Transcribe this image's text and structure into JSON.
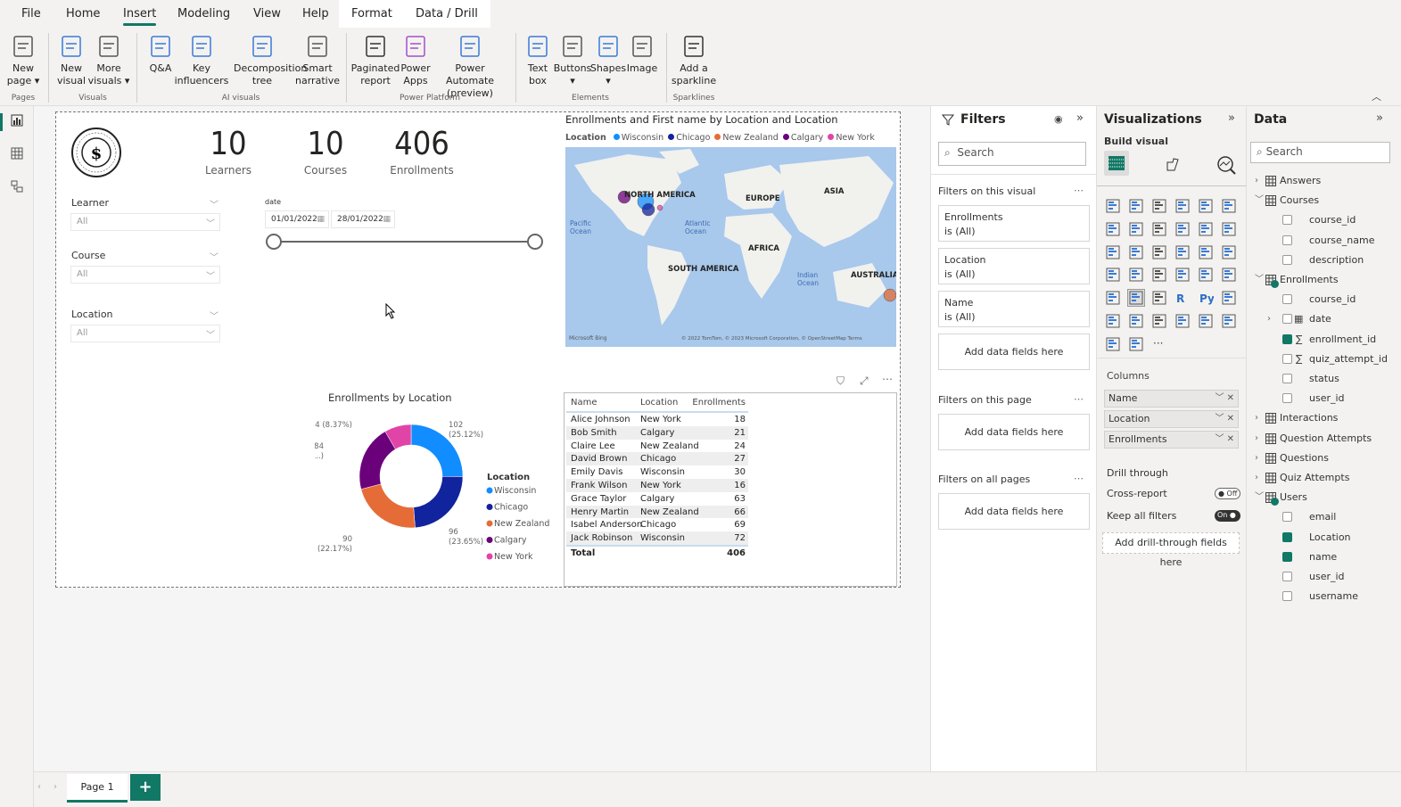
{
  "menu_tabs": [
    {
      "label": "File"
    },
    {
      "label": "Home"
    },
    {
      "label": "Insert",
      "active": true
    },
    {
      "label": "Modeling"
    },
    {
      "label": "View"
    },
    {
      "label": "Help"
    },
    {
      "label": "Format",
      "contextual": true
    },
    {
      "label": "Data / Drill",
      "contextual": true
    }
  ],
  "ribbon": {
    "buttons": [
      {
        "lines": [
          "New",
          "page ▾"
        ],
        "icon": "new-page-icon"
      },
      {
        "lines": [
          "New",
          "visual"
        ],
        "icon": "new-visual-icon"
      },
      {
        "lines": [
          "More",
          "visuals ▾"
        ],
        "icon": "more-visuals-icon"
      },
      {
        "lines": [
          "Q&A",
          ""
        ],
        "icon": "qa-icon"
      },
      {
        "lines": [
          "Key",
          "influencers"
        ],
        "icon": "key-influencers-icon"
      },
      {
        "lines": [
          "Decomposition",
          "tree"
        ],
        "icon": "decomposition-tree-icon"
      },
      {
        "lines": [
          "Smart",
          "narrative"
        ],
        "icon": "smart-narrative-icon"
      },
      {
        "lines": [
          "Paginated",
          "report"
        ],
        "icon": "paginated-report-icon"
      },
      {
        "lines": [
          "Power",
          "Apps"
        ],
        "icon": "power-apps-icon"
      },
      {
        "lines": [
          "Power Automate",
          "(preview)"
        ],
        "icon": "power-automate-icon"
      },
      {
        "lines": [
          "Text",
          "box"
        ],
        "icon": "text-box-icon"
      },
      {
        "lines": [
          "Buttons",
          "▾"
        ],
        "icon": "buttons-icon"
      },
      {
        "lines": [
          "Shapes",
          "▾"
        ],
        "icon": "shapes-icon"
      },
      {
        "lines": [
          "Image",
          ""
        ],
        "icon": "image-icon"
      },
      {
        "lines": [
          "Add a",
          "sparkline"
        ],
        "icon": "sparkline-icon"
      }
    ],
    "groups": [
      "Pages",
      "Visuals",
      "AI visuals",
      "Power Platform",
      "Elements",
      "Sparklines"
    ]
  },
  "left_rail": [
    {
      "icon": "report-view-icon"
    },
    {
      "icon": "table-view-icon"
    },
    {
      "icon": "model-view-icon"
    }
  ],
  "report": {
    "kpis": [
      {
        "value": "10",
        "label": "Learners"
      },
      {
        "value": "10",
        "label": "Courses"
      },
      {
        "value": "406",
        "label": "Enrollments"
      }
    ],
    "slicers": [
      {
        "title": "Learner",
        "value": "All"
      },
      {
        "title": "Course",
        "value": "All"
      },
      {
        "title": "Location",
        "value": "All"
      }
    ],
    "date_slicer": {
      "title": "date",
      "start": "01/01/2022",
      "end": "28/01/2022",
      "range_fraction": [
        0,
        1
      ]
    },
    "map": {
      "title": "Enrollments and First name by Location and Location",
      "legend_title": "Location",
      "labels": [
        "NORTH AMERICA",
        "EUROPE",
        "ASIA",
        "AFRICA",
        "SOUTH AMERICA",
        "AUSTRALIA",
        "Pacific Ocean",
        "Atlantic Ocean",
        "Indian Ocean"
      ],
      "attribution": "© 2022 TomTom, © 2023 Microsoft Corporation, © OpenStreetMap  Terms",
      "brand": "Microsoft Bing"
    },
    "table": {
      "headers": [
        "Name",
        "Location",
        "Enrollments"
      ],
      "rows": [
        [
          "Alice Johnson",
          "New York",
          "18"
        ],
        [
          "Bob Smith",
          "Calgary",
          "21"
        ],
        [
          "Claire Lee",
          "New Zealand",
          "24"
        ],
        [
          "David Brown",
          "Chicago",
          "27"
        ],
        [
          "Emily Davis",
          "Wisconsin",
          "30"
        ],
        [
          "Frank Wilson",
          "New York",
          "16"
        ],
        [
          "Grace Taylor",
          "Calgary",
          "63"
        ],
        [
          "Henry Martin",
          "New Zealand",
          "66"
        ],
        [
          "Isabel Anderson",
          "Chicago",
          "69"
        ],
        [
          "Jack Robinson",
          "Wisconsin",
          "72"
        ]
      ],
      "total": [
        "Total",
        "",
        "406"
      ]
    }
  },
  "chart_data": {
    "type": "pie",
    "donut": true,
    "title": "Enrollments by Location",
    "legend_title": "Location",
    "legend_position": "right",
    "categories": [
      "Wisconsin",
      "Chicago",
      "New Zealand",
      "Calgary",
      "New York"
    ],
    "values": [
      102,
      96,
      90,
      84,
      34
    ],
    "data_labels": [
      "102\n(25.12%)",
      "96\n(23.65%)",
      "90\n(22.17%)",
      "84\n(20.6...)",
      "34 (8.37%)"
    ],
    "colors": [
      "#118DFF",
      "#12239E",
      "#E66C37",
      "#6B007B",
      "#E044A7"
    ]
  },
  "filters": {
    "title": "Filters",
    "search_placeholder": "Search",
    "on_visual_label": "Filters on this visual",
    "visual_filters": [
      {
        "field": "Enrollments",
        "state": "is (All)"
      },
      {
        "field": "Location",
        "state": "is (All)"
      },
      {
        "field": "Name",
        "state": "is (All)"
      }
    ],
    "add_fields": "Add data fields here",
    "on_page_label": "Filters on this page",
    "all_pages_label": "Filters on all pages"
  },
  "visualizations": {
    "title": "Visualizations",
    "build_visual": "Build visual",
    "columns_label": "Columns",
    "columns": [
      "Name",
      "Location",
      "Enrollments"
    ],
    "drill_through": "Drill through",
    "cross_report": {
      "label": "Cross-report",
      "state": "Off"
    },
    "keep_all_filters": {
      "label": "Keep all filters",
      "state": "On"
    },
    "add_drill": "Add drill-through fields here",
    "selected_visual": "table",
    "visual_icons": [
      "stacked-bar",
      "stacked-column",
      "clustered-bar",
      "clustered-column",
      "100-stacked-bar",
      "100-stacked-column",
      "line",
      "area",
      "stacked-area",
      "line-clustered-column",
      "line-stacked-column",
      "ribbon",
      "waterfall",
      "funnel",
      "scatter",
      "pie",
      "donut",
      "treemap",
      "map",
      "filled-map",
      "gauge",
      "card",
      "multi-row-card",
      "kpi",
      "slicer",
      "table",
      "matrix",
      "r-visual",
      "python-visual",
      "key-influencers",
      "decomposition-tree",
      "qa",
      "smart-narrative",
      "metrics",
      "paginated",
      "azure-map",
      "power-apps",
      "power-automate",
      "more"
    ]
  },
  "data_pane": {
    "title": "Data",
    "search_placeholder": "Search",
    "tree": [
      {
        "label": "Answers",
        "type": "table",
        "expanded": false
      },
      {
        "label": "Courses",
        "type": "table",
        "expanded": true
      },
      {
        "label": "course_id",
        "type": "field",
        "checked": false
      },
      {
        "label": "course_name",
        "type": "field",
        "checked": false
      },
      {
        "label": "description",
        "type": "field",
        "checked": false
      },
      {
        "label": "Enrollments",
        "type": "table",
        "expanded": true,
        "used": true
      },
      {
        "label": "course_id",
        "type": "field",
        "checked": false
      },
      {
        "label": "date",
        "type": "date",
        "checked": false
      },
      {
        "label": "enrollment_id",
        "type": "sum",
        "checked": true
      },
      {
        "label": "quiz_attempt_id",
        "type": "sum",
        "checked": false
      },
      {
        "label": "status",
        "type": "field",
        "checked": false
      },
      {
        "label": "user_id",
        "type": "field",
        "checked": false
      },
      {
        "label": "Interactions",
        "type": "table",
        "expanded": false
      },
      {
        "label": "Question Attempts",
        "type": "table",
        "expanded": false
      },
      {
        "label": "Questions",
        "type": "table",
        "expanded": false
      },
      {
        "label": "Quiz Attempts",
        "type": "table",
        "expanded": false
      },
      {
        "label": "Users",
        "type": "table",
        "expanded": true,
        "used": true
      },
      {
        "label": "email",
        "type": "field",
        "checked": false
      },
      {
        "label": "Location",
        "type": "field",
        "checked": true
      },
      {
        "label": "name",
        "type": "field",
        "checked": true
      },
      {
        "label": "user_id",
        "type": "field",
        "checked": false
      },
      {
        "label": "username",
        "type": "field",
        "checked": false
      }
    ]
  },
  "pages": {
    "tabs": [
      {
        "label": "Page 1",
        "active": true
      }
    ],
    "add_label": "+"
  },
  "accent": "#117865"
}
